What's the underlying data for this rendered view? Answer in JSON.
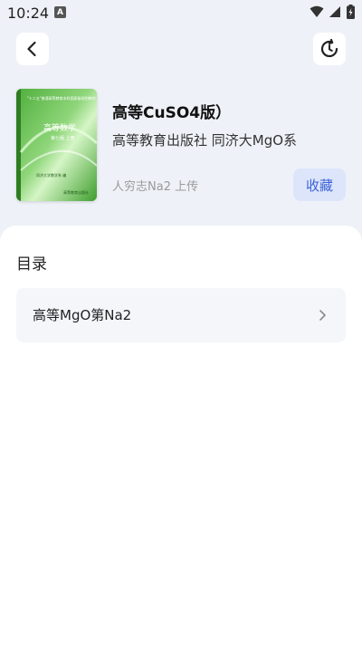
{
  "status_bar": {
    "time": "10:24",
    "notification_glyph": "A",
    "icons": [
      "wifi-icon",
      "signal-icon",
      "battery-charging-icon"
    ]
  },
  "header": {
    "back_icon": "chevron-left-icon",
    "refresh_icon": "refresh-icon"
  },
  "book": {
    "title": "高等CuSO4版）",
    "publisher": "高等教育出版社 同济大MgO系",
    "uploader": "人穷志Na2 上传",
    "collect_label": "收藏",
    "cover": {
      "series_line": "\"十二五\"普通高等教育本科国家级规划教材",
      "title": "高等数学",
      "edition": "第七版 上册",
      "author": "同济大学数学系 编",
      "publisher": "高等教育出版社"
    }
  },
  "toc": {
    "heading": "目录",
    "items": [
      {
        "label": "高等MgO第Na2"
      }
    ]
  },
  "colors": {
    "accent": "#3d63d6",
    "accent_bg": "#dde5fb",
    "page_bg": "#eef1f7"
  }
}
